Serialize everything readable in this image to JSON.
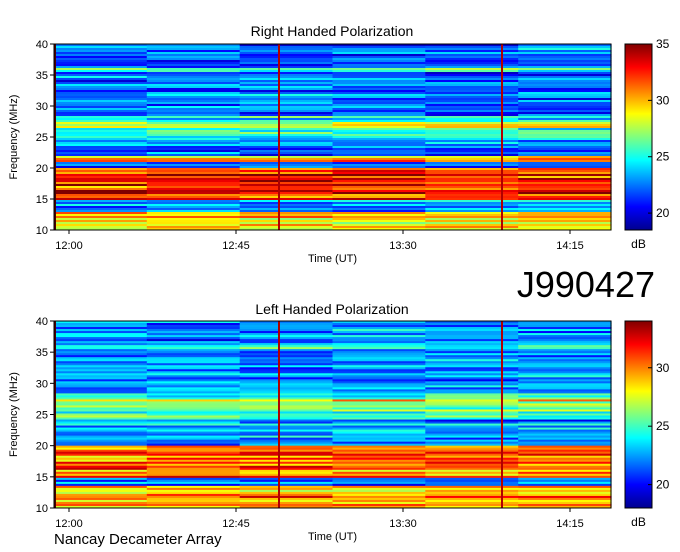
{
  "id_label": "J990427",
  "footer": "Nancay Decameter Array",
  "chart_data": [
    {
      "type": "heatmap",
      "title": "Right Handed Polarization",
      "xlabel": "Time (UT)",
      "ylabel": "Frequency (MHz)",
      "xticks": [
        "12:00",
        "12:45",
        "13:30",
        "14:15"
      ],
      "yticks": [
        10,
        15,
        20,
        25,
        30,
        35,
        40
      ],
      "ylim": [
        10,
        40
      ],
      "colorbar": {
        "label": "dB",
        "ticks": [
          20,
          25,
          30,
          35
        ],
        "range": [
          18.5,
          35
        ]
      },
      "bands": [
        {
          "from": 10,
          "to": 13,
          "level": 30
        },
        {
          "from": 15,
          "to": 20,
          "level": 32
        },
        {
          "from": 21,
          "to": 22,
          "level": 29
        },
        {
          "from": 26.5,
          "to": 27.5,
          "level": 29
        },
        {
          "from": 35.5,
          "to": 36,
          "level": 26
        }
      ]
    },
    {
      "type": "heatmap",
      "title": "Left Handed Polarization",
      "xlabel": "Time (UT)",
      "ylabel": "Frequency (MHz)",
      "xticks": [
        "12:00",
        "12:45",
        "13:30",
        "14:15"
      ],
      "yticks": [
        10,
        15,
        20,
        25,
        30,
        35,
        40
      ],
      "ylim": [
        10,
        40
      ],
      "colorbar": {
        "label": "dB",
        "ticks": [
          20,
          25,
          30
        ],
        "range": [
          18,
          34
        ]
      },
      "bands": [
        {
          "from": 10,
          "to": 13.5,
          "level": 30
        },
        {
          "from": 15,
          "to": 20,
          "level": 30
        },
        {
          "from": 26.5,
          "to": 27.5,
          "level": 28
        },
        {
          "from": 35.5,
          "to": 36,
          "level": 26
        }
      ]
    }
  ]
}
